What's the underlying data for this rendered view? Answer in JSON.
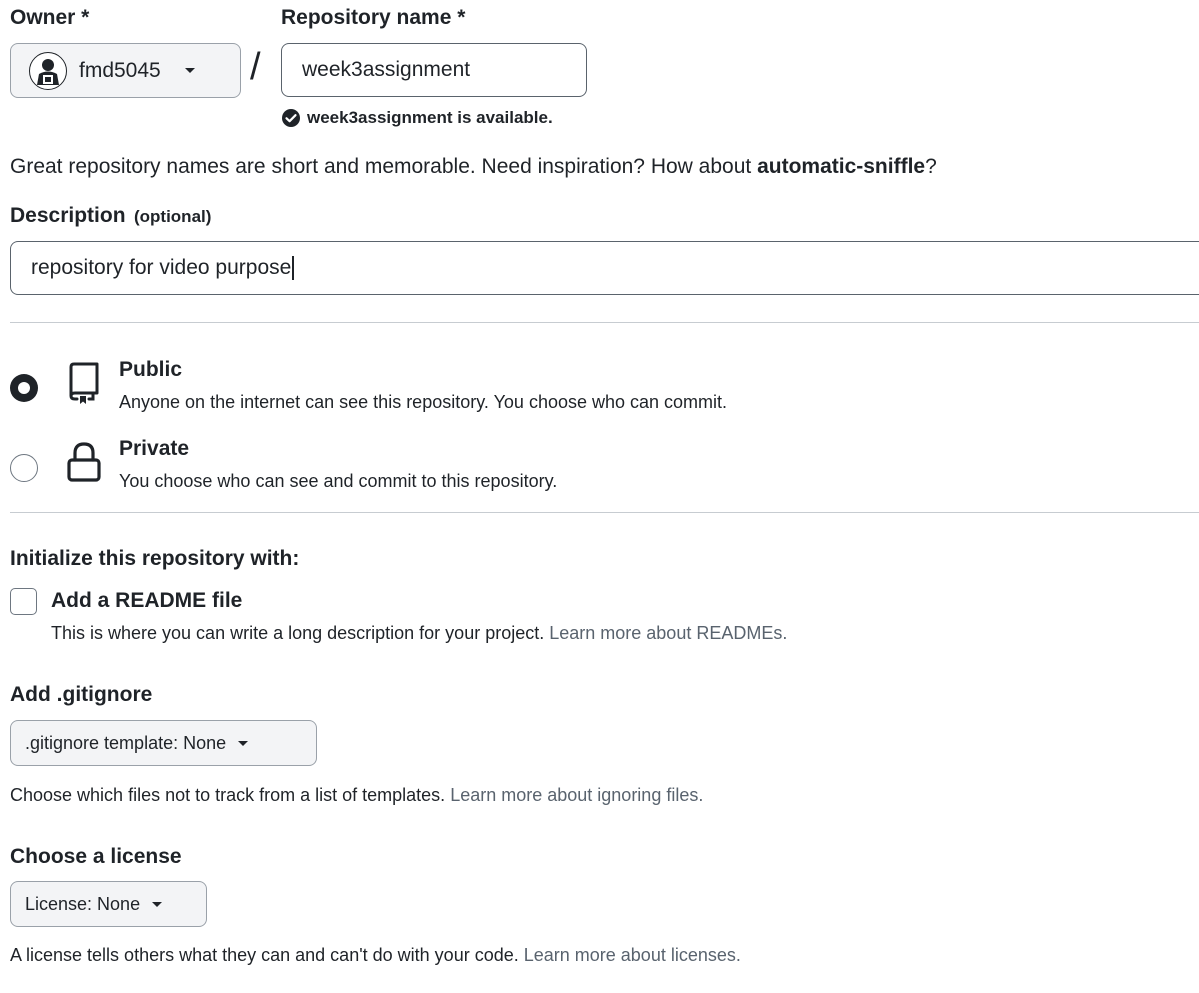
{
  "owner": {
    "label": "Owner *",
    "value": "fmd5045"
  },
  "separator": "/",
  "repo_name": {
    "label": "Repository name *",
    "value": "week3assignment",
    "availability": "week3assignment is available."
  },
  "hint": {
    "prefix": "Great repository names are short and memorable. Need inspiration? How about ",
    "suggestion": "automatic-sniffle",
    "suffix": "?"
  },
  "description": {
    "label": "Description",
    "optional": "(optional)",
    "value": "repository for video purpose"
  },
  "visibility": {
    "selected": "public",
    "options": [
      {
        "title": "Public",
        "desc": "Anyone on the internet can see this repository. You choose who can commit.",
        "icon": "repo-icon"
      },
      {
        "title": "Private",
        "desc": "You choose who can see and commit to this repository.",
        "icon": "lock-icon"
      }
    ]
  },
  "initialize": {
    "heading": "Initialize this repository with:",
    "readme": {
      "label": "Add a README file",
      "checked": false,
      "desc": "This is where you can write a long description for your project. ",
      "link": "Learn more about READMEs."
    }
  },
  "gitignore": {
    "heading": "Add .gitignore",
    "button": ".gitignore template: None",
    "desc": "Choose which files not to track from a list of templates. ",
    "link": "Learn more about ignoring files."
  },
  "license": {
    "heading": "Choose a license",
    "button": "License: None",
    "desc": "A license tells others what they can and can't do with your code. ",
    "link": "Learn more about licenses."
  },
  "colors": {
    "text": "#1f2328",
    "muted": "#59636e",
    "border": "#9aa1a9",
    "button_bg": "#f3f4f6",
    "success": "#1f2328"
  }
}
